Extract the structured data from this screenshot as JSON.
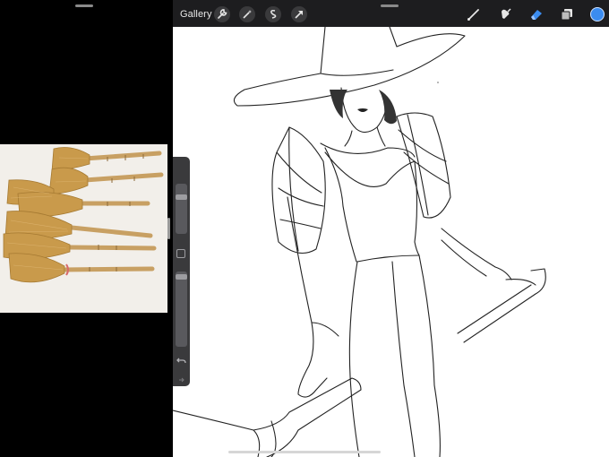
{
  "topbar": {
    "gallery_label": "Gallery",
    "left_tools": [
      "wrench-icon",
      "magic-wand-icon",
      "selection-icon",
      "transform-arrow-icon"
    ],
    "right_tools": [
      "brush-icon",
      "smudge-icon",
      "eraser-icon",
      "layers-icon"
    ],
    "active_color": "#3b8cf0",
    "eraser_active_color": "#3b8cf0"
  },
  "sidebar": {
    "brush_size_level": 0.23,
    "opacity_level": 0.04,
    "icons": [
      "modify-square-icon",
      "undo-icon",
      "redo-icon"
    ]
  },
  "reference_photo": {
    "subject": "broom-brushes-photo"
  }
}
